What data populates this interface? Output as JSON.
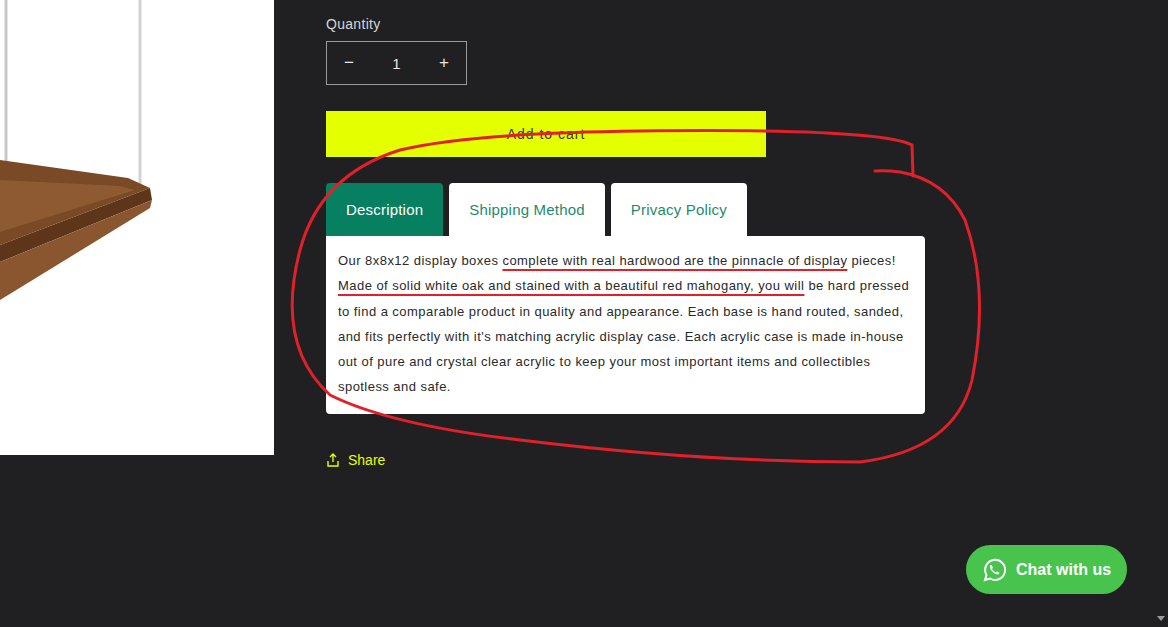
{
  "quantity": {
    "label": "Quantity",
    "decrement": "−",
    "value": "1",
    "increment": "+"
  },
  "add_to_cart": "Add to cart",
  "tabs": [
    {
      "label": "Description",
      "selected": true
    },
    {
      "label": "Shipping Method",
      "selected": false
    },
    {
      "label": "Privacy Policy",
      "selected": false
    }
  ],
  "description": [
    {
      "text": "Our 8x8x12 display boxes ",
      "highlighted": false
    },
    {
      "text": "complete with real hardwood are the pinnacle of display",
      "highlighted": true
    },
    {
      "text": " pieces! ",
      "highlighted": false
    },
    {
      "text": "Made of solid white oak and stained with a beautiful red mahogany, you will",
      "highlighted": true
    },
    {
      "text": " be hard pressed to find a comparable product in quality and appearance. Each base is hand routed, sanded, and fits perfectly with it's matching acrylic display case. Each acrylic case is made in-house out of pure and crystal clear acrylic to keep your most important items and collectibles spotless and safe.",
      "highlighted": false
    }
  ],
  "share": "Share",
  "chat": "Chat with us"
}
